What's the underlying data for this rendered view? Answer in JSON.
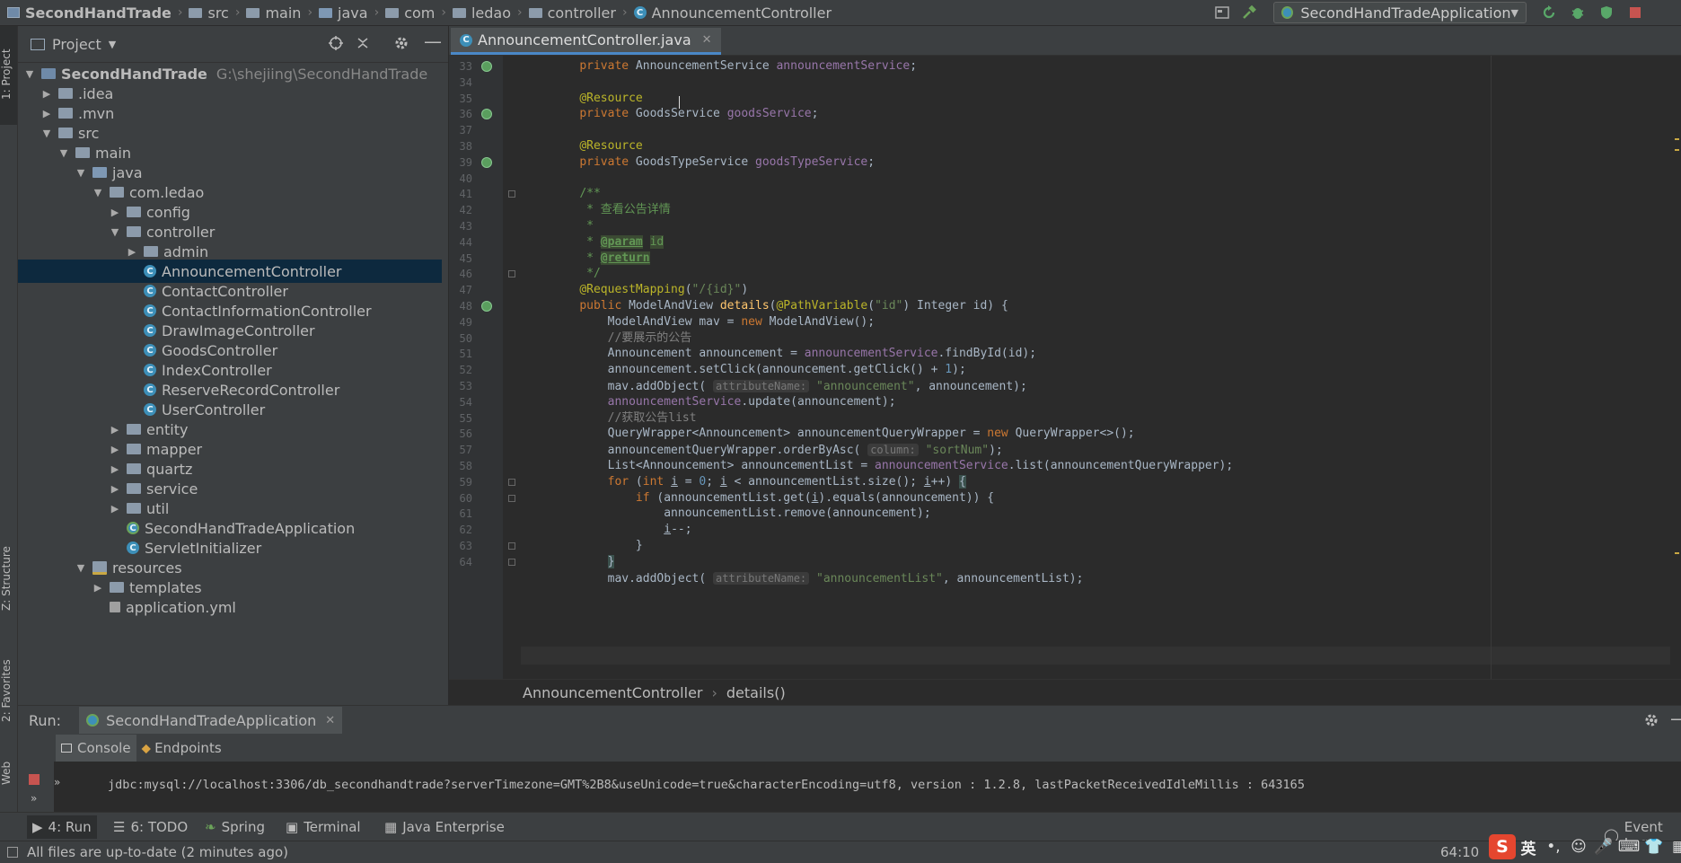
{
  "navbar": {
    "crumbs": [
      "SecondHandTrade",
      "src",
      "main",
      "java",
      "com",
      "ledao",
      "controller",
      "AnnouncementController"
    ],
    "run_config": "SecondHandTradeApplication"
  },
  "left_strip": {
    "project_tab": "1: Project",
    "structure_tab": "Z: Structure",
    "favorites_tab": "2: Favorites",
    "web_tab": "Web"
  },
  "project_panel": {
    "title": "Project",
    "tree": [
      {
        "label": "SecondHandTrade",
        "hint": "G:\\shejiing\\SecondHandTrade",
        "depth": 0,
        "arrow": "open",
        "icon": "project"
      },
      {
        "label": ".idea",
        "depth": 1,
        "arrow": "closed",
        "icon": "folder"
      },
      {
        "label": ".mvn",
        "depth": 1,
        "arrow": "closed",
        "icon": "folder"
      },
      {
        "label": "src",
        "depth": 1,
        "arrow": "open",
        "icon": "folder"
      },
      {
        "label": "main",
        "depth": 2,
        "arrow": "open",
        "icon": "folder"
      },
      {
        "label": "java",
        "depth": 3,
        "arrow": "open",
        "icon": "src"
      },
      {
        "label": "com.ledao",
        "depth": 4,
        "arrow": "open",
        "icon": "pkg"
      },
      {
        "label": "config",
        "depth": 5,
        "arrow": "closed",
        "icon": "pkg"
      },
      {
        "label": "controller",
        "depth": 5,
        "arrow": "open",
        "icon": "pkg"
      },
      {
        "label": "admin",
        "depth": 6,
        "arrow": "closed",
        "icon": "pkg"
      },
      {
        "label": "AnnouncementController",
        "depth": 6,
        "arrow": "none",
        "icon": "class",
        "selected": true
      },
      {
        "label": "ContactController",
        "depth": 6,
        "arrow": "none",
        "icon": "class"
      },
      {
        "label": "ContactInformationController",
        "depth": 6,
        "arrow": "none",
        "icon": "class"
      },
      {
        "label": "DrawImageController",
        "depth": 6,
        "arrow": "none",
        "icon": "class"
      },
      {
        "label": "GoodsController",
        "depth": 6,
        "arrow": "none",
        "icon": "class"
      },
      {
        "label": "IndexController",
        "depth": 6,
        "arrow": "none",
        "icon": "class"
      },
      {
        "label": "ReserveRecordController",
        "depth": 6,
        "arrow": "none",
        "icon": "class"
      },
      {
        "label": "UserController",
        "depth": 6,
        "arrow": "none",
        "icon": "class"
      },
      {
        "label": "entity",
        "depth": 5,
        "arrow": "closed",
        "icon": "pkg"
      },
      {
        "label": "mapper",
        "depth": 5,
        "arrow": "closed",
        "icon": "pkg"
      },
      {
        "label": "quartz",
        "depth": 5,
        "arrow": "closed",
        "icon": "pkg"
      },
      {
        "label": "service",
        "depth": 5,
        "arrow": "closed",
        "icon": "pkg"
      },
      {
        "label": "util",
        "depth": 5,
        "arrow": "closed",
        "icon": "pkg"
      },
      {
        "label": "SecondHandTradeApplication",
        "depth": 5,
        "arrow": "none",
        "icon": "appclass"
      },
      {
        "label": "ServletInitializer",
        "depth": 5,
        "arrow": "none",
        "icon": "class"
      },
      {
        "label": "resources",
        "depth": 3,
        "arrow": "open",
        "icon": "res"
      },
      {
        "label": "templates",
        "depth": 4,
        "arrow": "closed",
        "icon": "folder"
      },
      {
        "label": "application.yml",
        "depth": 4,
        "arrow": "none",
        "icon": "file"
      }
    ]
  },
  "editor": {
    "tab_label": "AnnouncementController.java",
    "lines": [
      {
        "n": "33",
        "html": "    <span class=\"kw\">private</span> AnnouncementService <span class=\"fld\">announcementService</span>;"
      },
      {
        "n": "34",
        "html": ""
      },
      {
        "n": "35",
        "html": "    <span class=\"ann\">@Resource</span>"
      },
      {
        "n": "36",
        "html": "    <span class=\"kw\">private</span> GoodsService <span class=\"fld\">goodsService</span>;"
      },
      {
        "n": "37",
        "html": ""
      },
      {
        "n": "38",
        "html": "    <span class=\"ann\">@Resource</span>"
      },
      {
        "n": "39",
        "html": "    <span class=\"kw\">private</span> GoodsTypeService <span class=\"fld\">goodsTypeService</span>;"
      },
      {
        "n": "40",
        "html": ""
      },
      {
        "n": "41",
        "html": "    <span class=\"cmt\">/**</span>"
      },
      {
        "n": "42",
        "html": "<span class=\"cmt\">     * 查看公告详情</span>"
      },
      {
        "n": "43",
        "html": "<span class=\"cmt\">     *</span>"
      },
      {
        "n": "44",
        "html": "<span class=\"cmt\">     * <span class=\"tag\">@param</span> <span style=\"background:#3b4a33\">id</span></span>"
      },
      {
        "n": "45",
        "html": "<span class=\"cmt\">     * <span class=\"tag\">@return</span></span>"
      },
      {
        "n": "46",
        "html": "<span class=\"cmt\">     */</span>"
      },
      {
        "n": "47",
        "html": "    <span class=\"ann\">@RequestMapping</span>(<span class=\"str\">\"/{id}\"</span>)"
      },
      {
        "n": "48",
        "html": "    <span class=\"kw\">public</span> ModelAndView <span class=\"fn\">details</span>(<span class=\"ann\">@PathVariable</span>(<span class=\"str\">\"id\"</span>) Integer id) {"
      },
      {
        "n": "49",
        "html": "        ModelAndView mav = <span class=\"kw\">new</span> ModelAndView();"
      },
      {
        "n": "50",
        "html": "        <span class=\"lc\">//要展示的公告</span>"
      },
      {
        "n": "51",
        "html": "        Announcement announcement = <span class=\"fld\">announcementService</span>.findById(id);"
      },
      {
        "n": "52",
        "html": "        announcement.setClick(announcement.getClick() + <span class=\"num\">1</span>);"
      },
      {
        "n": "53",
        "html": "        mav.addObject( <span class=\"hint-box\">attributeName:</span> <span class=\"str\">\"announcement\"</span>, announcement);"
      },
      {
        "n": "54",
        "html": "        <span class=\"fld\">announcementService</span>.update(announcement);"
      },
      {
        "n": "55",
        "html": "        <span class=\"lc\">//获取公告list</span>"
      },
      {
        "n": "56",
        "html": "        QueryWrapper&lt;Announcement&gt; announcementQueryWrapper = <span class=\"kw\">new</span> QueryWrapper&lt;&gt;();"
      },
      {
        "n": "57",
        "html": "        announcementQueryWrapper.orderByAsc( <span class=\"hint-box\">column:</span> <span class=\"str\">\"sortNum\"</span>);"
      },
      {
        "n": "58",
        "html": "        List&lt;Announcement&gt; announcementList = <span class=\"fld\">announcementService</span>.list(announcementQueryWrapper);"
      },
      {
        "n": "59",
        "html": "        <span class=\"kw\">for</span> (<span class=\"kw\">int</span> <u>i</u> = <span class=\"num\">0</span>; <u>i</u> &lt; announcementList.size(); <u>i</u>++) <span style=\"background:#3b514d\">{</span>"
      },
      {
        "n": "60",
        "html": "            <span class=\"kw\">if</span> (announcementList.get(<u>i</u>).equals(announcement)) {"
      },
      {
        "n": "61",
        "html": "                announcementList.remove(announcement);"
      },
      {
        "n": "62",
        "html": "                <u>i</u>--;"
      },
      {
        "n": "63",
        "html": "            }"
      },
      {
        "n": "64",
        "html": "        <span style=\"background:#3b514d\">}</span>"
      },
      {
        "n": "",
        "html": "        mav.addObject( <span class=\"hint-box\">attributeName:</span> <span class=\"str\">\"announcementList\"</span>, announcementList);"
      }
    ],
    "breadcrumb_class": "AnnouncementController",
    "breadcrumb_method": "details()"
  },
  "run_panel": {
    "label": "Run:",
    "config_tab": "SecondHandTradeApplication",
    "console_tab": "Console",
    "endpoints_tab": "Endpoints",
    "console_line": "jdbc:mysql://localhost:3306/db_secondhandtrade?serverTimezone=GMT%2B8&useUnicode=true&characterEncoding=utf8, version : 1.2.8, lastPacketReceivedIdleMillis : 643165"
  },
  "toolbar_bottom": {
    "run": "4: Run",
    "todo": "6: TODO",
    "spring": "Spring",
    "terminal": "Terminal",
    "java_enterprise": "Java Enterprise",
    "event_log": "Event Log"
  },
  "status": {
    "message": "All files are up-to-date (2 minutes ago)",
    "position": "64:10"
  },
  "ime": {
    "lang": "英"
  },
  "colors": {
    "accent": "#4a88c7",
    "selection": "#0d293e",
    "panel": "#3c3f41",
    "editor_bg": "#2b2b2b"
  }
}
